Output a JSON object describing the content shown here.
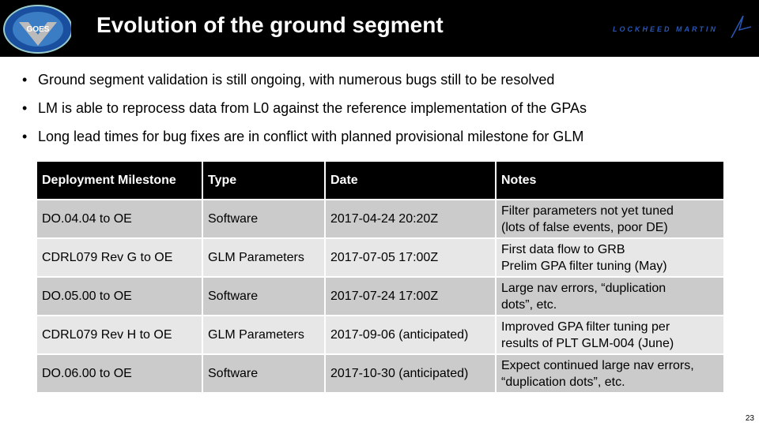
{
  "header": {
    "title": "Evolution of the ground segment",
    "left_logo": "GOES-R NOAA NASA",
    "right_logo": "LOCKHEED MARTIN"
  },
  "bullets": [
    "Ground segment validation is still ongoing, with numerous bugs still to be resolved",
    "LM is able to reprocess data from L0 against the reference implementation of the GPAs",
    "Long lead times for bug fixes are in conflict with planned provisional milestone for GLM"
  ],
  "table": {
    "headers": [
      "Deployment Milestone",
      "Type",
      "Date",
      "Notes"
    ],
    "rows": [
      [
        "DO.04.04 to OE",
        "Software",
        "2017-04-24 20:20Z",
        "Filter parameters not yet tuned",
        "(lots of false events, poor DE)"
      ],
      [
        "CDRL079 Rev G to OE",
        "GLM Parameters",
        "2017-07-05 17:00Z",
        "First data flow to GRB",
        "Prelim GPA filter tuning (May)"
      ],
      [
        "DO.05.00 to OE",
        "Software",
        "2017-07-24 17:00Z",
        "Large nav errors, “duplication",
        "dots”, etc."
      ],
      [
        "CDRL079 Rev H to OE",
        "GLM Parameters",
        "2017-09-06 (anticipated)",
        "Improved GPA filter tuning per",
        "results of PLT GLM-004 (June)"
      ],
      [
        "DO.06.00 to OE",
        "Software",
        "2017-10-30 (anticipated)",
        "Expect continued large nav errors,",
        "“duplication dots”, etc."
      ]
    ]
  },
  "page_number": "23"
}
